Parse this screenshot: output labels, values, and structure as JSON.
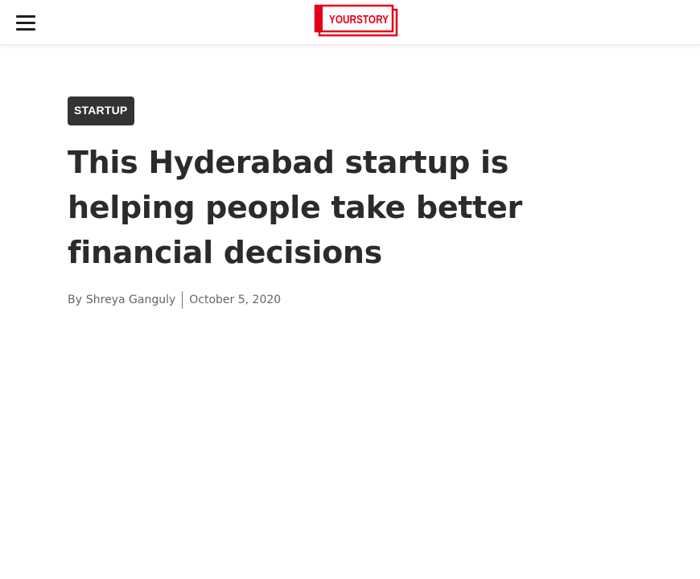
{
  "header": {
    "menu_icon": "hamburger-menu-icon",
    "logo_text": "YOURSTORY",
    "brand_color": "#e5001a"
  },
  "article": {
    "category": "STARTUP",
    "title": "This Hyderabad startup is helping people take better financial decisions",
    "byline": {
      "prefix": "By",
      "author": "Shreya Ganguly",
      "date": "October 5, 2020"
    }
  },
  "colors": {
    "badge_bg": "#333333",
    "title_text": "#2b2b2b",
    "meta_text": "#666666"
  }
}
